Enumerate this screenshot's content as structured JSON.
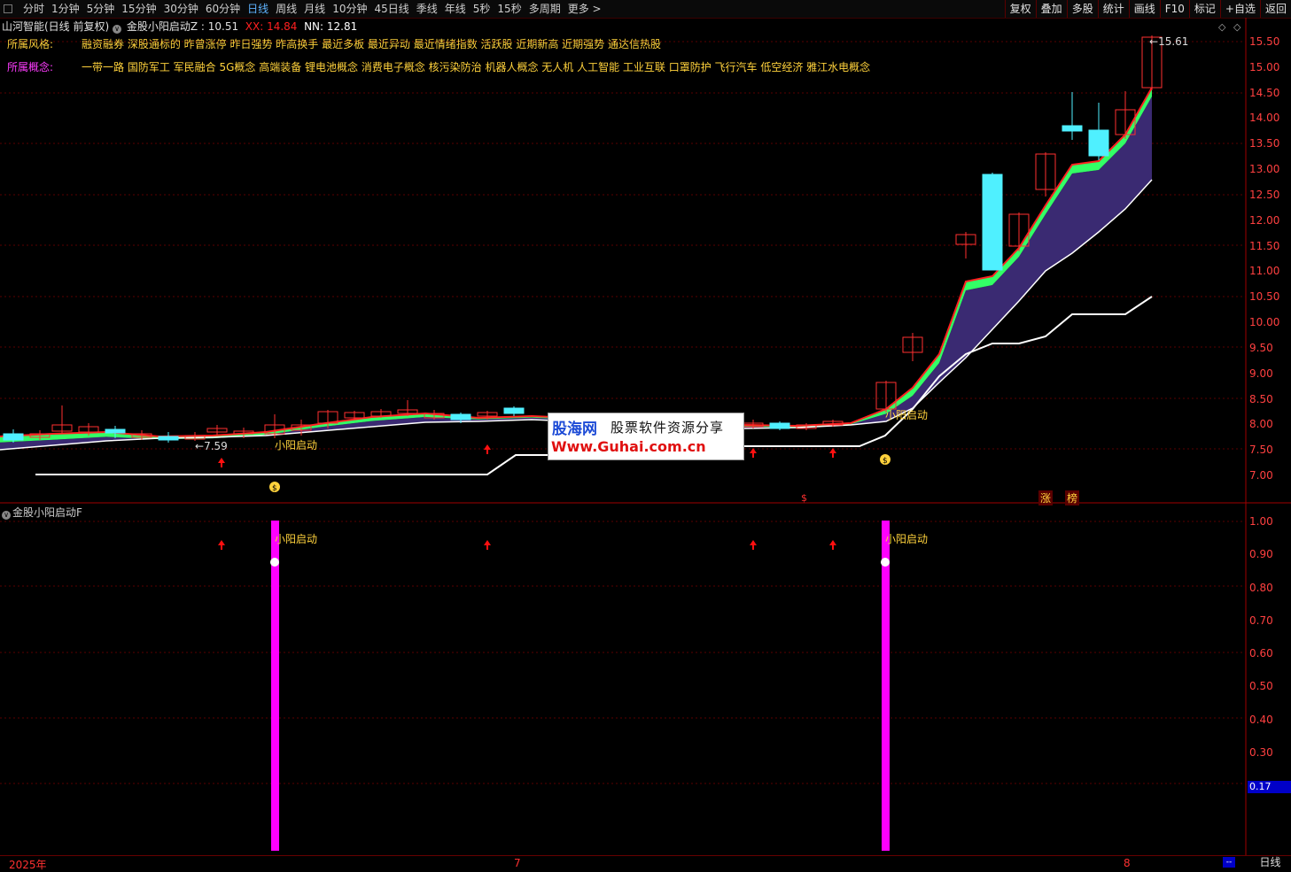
{
  "toolbar": {
    "periods": [
      "分时",
      "1分钟",
      "5分钟",
      "15分钟",
      "30分钟",
      "60分钟",
      "日线",
      "周线",
      "月线",
      "10分钟",
      "45日线",
      "季线",
      "年线",
      "5秒",
      "15秒",
      "多周期",
      "更多 >"
    ],
    "active_period": "日线",
    "right_buttons": [
      "复权",
      "叠加",
      "多股",
      "统计",
      "画线",
      "F10",
      "标记",
      "+自选",
      "返回"
    ]
  },
  "header": {
    "stock": "山河智能(日线 前复权)",
    "indicator": "金股小阳启动Z",
    "ind_value": ": 10.51",
    "xx_label": "XX:",
    "xx_value": "14.84",
    "nn_label": "NN:",
    "nn_value": "12.81",
    "colors": {
      "xx": "#ff2020",
      "nn": "#ffffff",
      "ind": "#e0e0e0"
    }
  },
  "style_row": {
    "label": "所属风格:",
    "values": "融资融券 深股通标的 昨曾涨停 昨日强势 昨高换手 最近多板 最近异动 最近情绪指数 活跃股 近期新高 近期强势 通达信热股"
  },
  "concept_row": {
    "label": "所属概念:",
    "values": "一带一路 国防军工 军民融合 5G概念 高端装备 锂电池概念 消费电子概念 核污染防治 机器人概念 无人机 人工智能 工业互联 口罩防护 飞行汽车 低空经济 雅江水电概念"
  },
  "main_chart": {
    "price_axis": [
      "15.50",
      "15.00",
      "14.50",
      "14.00",
      "13.50",
      "13.00",
      "12.50",
      "12.00",
      "11.50",
      "11.00",
      "10.50",
      "10.00",
      "9.50",
      "9.00",
      "8.50",
      "8.00",
      "7.50",
      "7.00"
    ],
    "low_marker": "7.59",
    "high_marker": "15.61",
    "signal_labels": [
      "小阳启动",
      "小阳启动"
    ],
    "badges": [
      "涨",
      "榜"
    ]
  },
  "indicator_panel": {
    "title": "金股小阳启动F",
    "axis": [
      "1.00",
      "0.90",
      "0.80",
      "0.70",
      "0.60",
      "0.50",
      "0.40",
      "0.30"
    ],
    "current_value": "0.17",
    "signal_labels": [
      "小阳启动",
      "小阳启动"
    ]
  },
  "bottom": {
    "year": "2025年",
    "month1": "7",
    "month2": "8",
    "period": "日线",
    "scroll": "--"
  },
  "watermark": {
    "site_cn": "股海网",
    "slogan": "股票软件资源分享",
    "url": "Www.Guhai.com.cn"
  },
  "colors": {
    "background": "#000000",
    "up": "#ff3030",
    "down": "#4ff0ff",
    "band_green": "#33ff66",
    "band_purple": "#3a2a72",
    "signal_bar": "#ff00ff",
    "label_yellow": "#ffd23c"
  }
}
